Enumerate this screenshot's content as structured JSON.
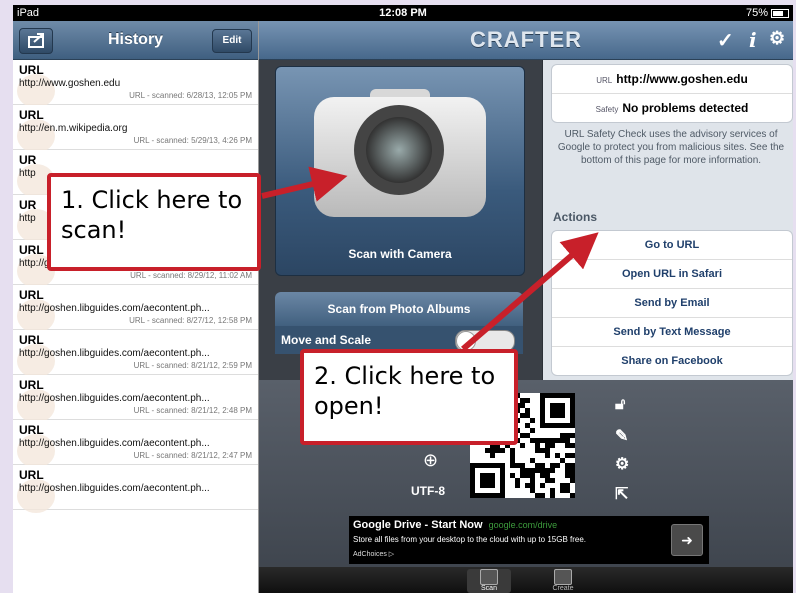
{
  "status": {
    "carrier": "iPad",
    "time": "12:08 PM",
    "battery": "75%"
  },
  "history": {
    "title": "History",
    "edit_label": "Edit",
    "items": [
      {
        "type": "URL",
        "url": "http://www.goshen.edu",
        "date": "URL - scanned: 6/28/13, 12:05 PM"
      },
      {
        "type": "URL",
        "url": "http://en.m.wikipedia.org",
        "date": "URL - scanned: 5/29/13, 4:26 PM"
      },
      {
        "type": "UR",
        "url": "http",
        "date": ""
      },
      {
        "type": "UR",
        "url": "http",
        "date": ""
      },
      {
        "type": "URL",
        "url": "http://goshen.libguides.com/aecontent.ph...",
        "date": "URL - scanned: 8/29/12, 11:02 AM"
      },
      {
        "type": "URL",
        "url": "http://goshen.libguides.com/aecontent.ph...",
        "date": "URL - scanned: 8/27/12, 12:58 PM"
      },
      {
        "type": "URL",
        "url": "http://goshen.libguides.com/aecontent.ph...",
        "date": "URL - scanned: 8/21/12, 2:59 PM"
      },
      {
        "type": "URL",
        "url": "http://goshen.libguides.com/aecontent.ph...",
        "date": "URL - scanned: 8/21/12, 2:48 PM"
      },
      {
        "type": "URL",
        "url": "http://goshen.libguides.com/aecontent.ph...",
        "date": "URL - scanned: 8/21/12, 2:47 PM"
      },
      {
        "type": "URL",
        "url": "http://goshen.libguides.com/aecontent.ph...",
        "date": ""
      }
    ]
  },
  "header": {
    "brand": "CRAFTER",
    "check_icon": "checkmark-icon",
    "info_icon": "info-icon",
    "settings_icon": "gear-icon"
  },
  "scan": {
    "camera_label": "Scan with Camera",
    "albums_label": "Scan from Photo Albums",
    "move_scale_label": "Move and Scale",
    "toggle_text": "O"
  },
  "result": {
    "url_key": "URL",
    "url_value": "http://www.goshen.edu",
    "safety_key": "Safety",
    "safety_value": "No problems detected",
    "note": "URL Safety Check uses the advisory services of Google to protect you from malicious sites. See the bottom of this page for more information.",
    "actions_title": "Actions",
    "actions": [
      "Go to URL",
      "Open URL in Safari",
      "Send by Email",
      "Send by Text Message",
      "Share on Facebook"
    ]
  },
  "bottom": {
    "encoding": "UTF-8"
  },
  "ad": {
    "title": "Google Drive - Start Now",
    "domain": "google.com/drive",
    "subtitle": "Store all files from your desktop to the cloud with up to 15GB free.",
    "choices": "AdChoices ▷"
  },
  "tabs": {
    "scan": "Scan",
    "create": "Create"
  },
  "callouts": {
    "scan": "1. Click here to scan!",
    "open": "2. Click here to open!"
  },
  "colors": {
    "callout_border": "#c8202a",
    "header_blue": "#47688b"
  }
}
